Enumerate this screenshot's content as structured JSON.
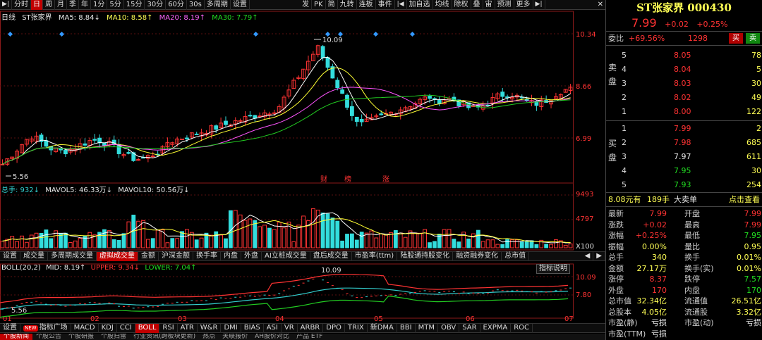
{
  "toolbar": {
    "left": [
      "分时",
      "日",
      "周",
      "月",
      "季",
      "年",
      "1分",
      "5分",
      "15分",
      "30分",
      "60分",
      "30s"
    ],
    "active": 1,
    "mid": [
      "多周期",
      "设置"
    ],
    "right": [
      "发",
      "PK",
      "简",
      "九转",
      "连板",
      "事件"
    ],
    "right2": [
      "加自选",
      "均线",
      "除权",
      "叠",
      "宙",
      "预测",
      "更多"
    ],
    "close": "✕"
  },
  "kline": {
    "period": "日线",
    "name": "ST张家界",
    "ma5": "MA5: 8.84↓",
    "ma10": "MA10: 8.58↑",
    "ma20": "MA20: 8.19↑",
    "ma30": "MA30: 7.79↑",
    "axis": [
      "10.34",
      "8.66",
      "6.99"
    ],
    "high_mark": "10.09",
    "low_mark": "5.56",
    "events": [
      "财",
      "榜",
      "涨"
    ]
  },
  "volume": {
    "total": "总手: 932↓",
    "mavol5": "MAVOL5: 46.33万↓",
    "mavol10": "MAVOL10: 50.56万↓",
    "axis": [
      "9493",
      "4797",
      "X100"
    ]
  },
  "tabs1": [
    "设置",
    "成交量",
    "多周期成交量",
    "虚拟成交量",
    "金额",
    "沪深金额",
    "换手率",
    "内盘",
    "外盘",
    "AI立桩成交量",
    "盘后成交量",
    "市盈率(ttm)",
    "陆股通持股变化",
    "融资融券变化",
    "总市值"
  ],
  "tabs1_active": 3,
  "boll": {
    "label": "BOLL(20,2)",
    "mid": "MID: 8.19↑",
    "upper": "UPPER: 9.34↓",
    "lower": "LOWER: 7.04↑",
    "axis": [
      "10.09",
      "7.80"
    ],
    "high_mark": "10.09",
    "low_mark": "5.56",
    "note_button": "指标说明"
  },
  "months": [
    "01",
    "02",
    "03",
    "04",
    "05",
    "06",
    "07"
  ],
  "tabs2": [
    "设置",
    "指标广场",
    "MACD",
    "KDJ",
    "CCI",
    "BOLL",
    "RSI",
    "ATR",
    "W&R",
    "DMI",
    "BIAS",
    "ASI",
    "VR",
    "ARBR",
    "DPO",
    "TRIX",
    "新DMA",
    "BBI",
    "MTM",
    "OBV",
    "SAR",
    "EXPMA",
    "ROC"
  ],
  "tabs2_active": 5,
  "tabs2_new": "NEW",
  "news": [
    "个股新闻",
    "个股公告",
    "个股研报",
    "个股扫雷",
    "行业资讯(跨板块更新)",
    "热点",
    "关联报价",
    "AH股价对比",
    "产品 ETF"
  ],
  "quote": {
    "title": "ST张家界 000430",
    "price": "7.99",
    "change": "+0.02",
    "pct": "+0.25%",
    "wb_label": "委比",
    "wb_value": "+69.56%",
    "wb_diff": "1298",
    "buy_btn": "买",
    "sell_btn": "卖",
    "sell_label": "卖盘",
    "buy_label": "买盘",
    "sells": [
      {
        "lv": "5",
        "p": "8.05",
        "v": "78"
      },
      {
        "lv": "4",
        "p": "8.04",
        "v": "5"
      },
      {
        "lv": "3",
        "p": "8.03",
        "v": "30"
      },
      {
        "lv": "2",
        "p": "8.02",
        "v": "49"
      },
      {
        "lv": "1",
        "p": "8.00",
        "v": "122"
      }
    ],
    "buys": [
      {
        "lv": "1",
        "p": "7.99",
        "v": "2"
      },
      {
        "lv": "2",
        "p": "7.98",
        "v": "685"
      },
      {
        "lv": "3",
        "p": "7.97",
        "v": "611"
      },
      {
        "lv": "4",
        "p": "7.95",
        "v": "30"
      },
      {
        "lv": "5",
        "p": "7.93",
        "v": "254"
      }
    ],
    "big_order": {
      "price": "8.08元有",
      "qty": "189手",
      "label": "大卖单",
      "link": "点击查看"
    },
    "stats": [
      {
        "k1": "最新",
        "v1": "7.99",
        "c1": "red",
        "k2": "开盘",
        "v2": "7.99",
        "c2": "red"
      },
      {
        "k1": "涨跌",
        "v1": "+0.02",
        "c1": "red",
        "k2": "最高",
        "v2": "7.99",
        "c2": "red"
      },
      {
        "k1": "涨幅",
        "v1": "+0.25%",
        "c1": "red",
        "k2": "最低",
        "v2": "7.95",
        "c2": "green"
      },
      {
        "k1": "振幅",
        "v1": "0.00%",
        "c1": "yellow",
        "k2": "量比",
        "v2": "0.95",
        "c2": "yellow"
      },
      {
        "k1": "总手",
        "v1": "340",
        "c1": "yellow",
        "k2": "换手",
        "v2": "0.01%",
        "c2": "yellow"
      },
      {
        "k1": "金额",
        "v1": "27.17万",
        "c1": "yellow",
        "k2": "换手(实)",
        "v2": "0.01%",
        "c2": "yellow"
      },
      {
        "k1": "涨停",
        "v1": "8.37",
        "c1": "red",
        "k2": "跌停",
        "v2": "7.57",
        "c2": "green"
      },
      {
        "k1": "外盘",
        "v1": "170",
        "c1": "red",
        "k2": "内盘",
        "v2": "170",
        "c2": "green"
      },
      {
        "k1": "总市值",
        "v1": "32.34亿",
        "c1": "yellow",
        "k2": "流通值",
        "v2": "26.51亿",
        "c2": "yellow"
      },
      {
        "k1": "总股本",
        "v1": "4.05亿",
        "c1": "yellow",
        "k2": "流通股",
        "v2": "3.32亿",
        "c2": "yellow"
      },
      {
        "k1": "市盈(静)",
        "v1": "亏损",
        "c1": "white",
        "k2": "市盈(动)",
        "v2": "亏损",
        "c2": "white"
      },
      {
        "k1": "市盈(TTM)",
        "v1": "亏损",
        "c1": "white",
        "k2": "",
        "v2": "",
        "c2": "white"
      }
    ]
  },
  "colors": {
    "up": "#ff3333",
    "down": "#33dddd",
    "ma5": "#ffffff",
    "ma10": "#ffff33",
    "ma20": "#ff55ff",
    "ma30": "#22cc22",
    "accent": "#c00000"
  }
}
